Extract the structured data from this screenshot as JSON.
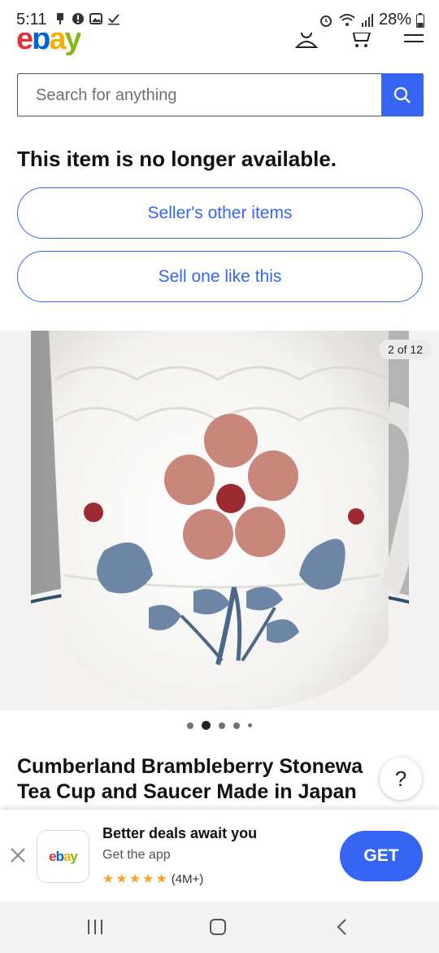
{
  "status_bar": {
    "time": "5:11",
    "battery": "28%"
  },
  "header": {
    "logo_letters": [
      "e",
      "b",
      "a",
      "y"
    ],
    "icons": [
      "user-icon",
      "cart-icon",
      "menu-icon"
    ]
  },
  "search": {
    "placeholder": "Search for anything"
  },
  "notice": {
    "text": "This item is no longer available."
  },
  "buttons": {
    "sellers_other_items": "Seller's other items",
    "sell_one_like_this": "Sell one like this"
  },
  "gallery": {
    "counter": "2 of 12",
    "current": 2,
    "total": 12
  },
  "listing": {
    "title_line1": "Cumberland Brambleberry Stonewa",
    "title_line2": "Tea Cup and Saucer Made in Japan"
  },
  "help": {
    "label": "?"
  },
  "app_banner": {
    "title": "Better deals await you",
    "subtitle": "Get the app",
    "rating_count": "(4M+)",
    "stars": 5,
    "get_label": "GET",
    "logo_letters": [
      "e",
      "b",
      "a",
      "y"
    ]
  },
  "colors": {
    "accent": "#3665f3",
    "logo_red": "#e53238",
    "logo_blue": "#0064d2",
    "logo_yellow": "#f5af02",
    "logo_green": "#86b817"
  }
}
